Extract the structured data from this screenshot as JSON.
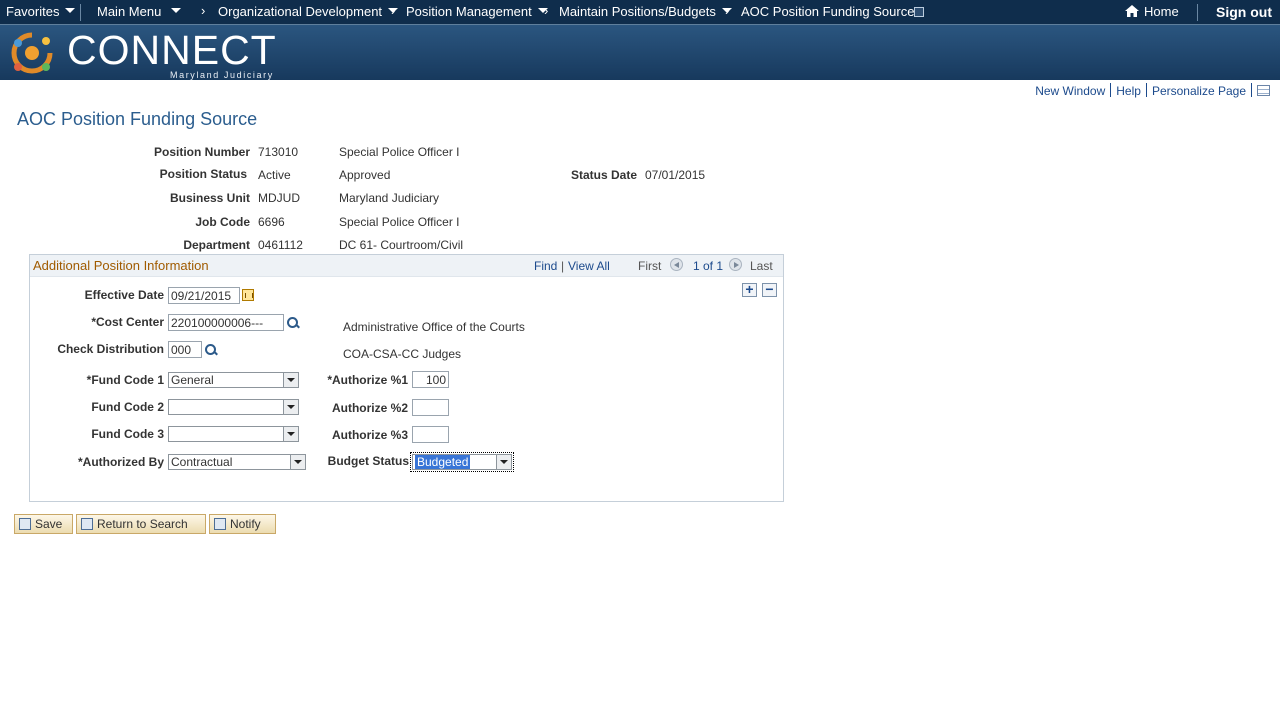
{
  "nav": {
    "favorites": "Favorites",
    "main_menu": "Main Menu",
    "breadcrumbs": [
      "Organizational Development",
      "Position Management",
      "Maintain Positions/Budgets",
      "AOC Position Funding Source"
    ],
    "home": "Home",
    "sign_out": "Sign out"
  },
  "banner": {
    "logo": "CONNECT",
    "subtitle": "Maryland Judiciary"
  },
  "page_links": {
    "new_window": "New Window",
    "help": "Help",
    "personalize": "Personalize Page"
  },
  "page_title": "AOC Position Funding Source",
  "header": {
    "position_number_label": "Position Number",
    "position_number": "713010",
    "position_desc": "Special Police Officer I",
    "position_status_label": "Position Status",
    "position_status": "Active",
    "approval": "Approved",
    "status_date_label": "Status Date",
    "status_date": "07/01/2015",
    "business_unit_label": "Business Unit",
    "business_unit": "MDJUD",
    "business_unit_desc": "Maryland Judiciary",
    "job_code_label": "Job Code",
    "job_code": "6696",
    "job_code_desc": "Special Police Officer I",
    "department_label": "Department",
    "department": "0461112",
    "department_desc": "DC 61- Courtroom/Civil"
  },
  "group": {
    "title": "Additional Position Information",
    "find": "Find",
    "view_all": "View All",
    "first": "First",
    "count": "1 of 1",
    "last": "Last",
    "effective_date_label": "Effective Date",
    "effective_date": "09/21/2015",
    "cost_center_label": "*Cost Center",
    "cost_center": "220100000006---",
    "cost_center_desc": "Administrative Office of the Courts",
    "check_dist_label": "Check Distribution",
    "check_dist": "000",
    "check_dist_desc": "COA-CSA-CC Judges",
    "fund_code1_label": "*Fund Code 1",
    "fund_code1": "General",
    "fund_code2_label": "Fund Code 2",
    "fund_code2": "",
    "fund_code3_label": "Fund Code 3",
    "fund_code3": "",
    "authorize1_label": "*Authorize %1",
    "authorize1": "100",
    "authorize2_label": "Authorize %2",
    "authorize2": "",
    "authorize3_label": "Authorize %3",
    "authorize3": "",
    "authorized_by_label": "*Authorized By",
    "authorized_by": "Contractual",
    "budget_status_label": "Budget Status",
    "budget_status": "Budgeted"
  },
  "buttons": {
    "save": "Save",
    "return": "Return to Search",
    "notify": "Notify"
  }
}
